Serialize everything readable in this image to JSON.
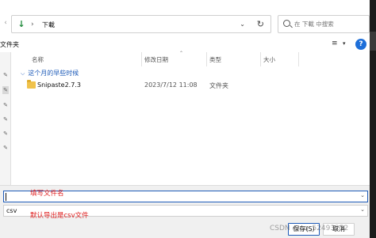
{
  "address_bar": {
    "breadcrumb": "下載",
    "separator": "›"
  },
  "search": {
    "placeholder": "在 下載 中搜索"
  },
  "toolbar": {
    "new_folder_label": "文件夹"
  },
  "columns": {
    "name": "名称",
    "date_modified": "修改日期",
    "type": "类型",
    "size": "大小"
  },
  "group": {
    "label": "这个月的早些时候"
  },
  "files": [
    {
      "name": "Snipaste2.7.3",
      "date_modified": "2023/7/12 11:08",
      "type": "文件夹"
    }
  ],
  "filename_field": {
    "annotation": "填写文件名"
  },
  "file_type": {
    "selected": "csv",
    "annotation": "默认导出是csv文件"
  },
  "buttons": {
    "save_label": "保存(S)",
    "cancel_label": "取消"
  },
  "watermark": {
    "text": "CSDN @qq_52493252"
  },
  "colors": {
    "accent": "#1e5bb8",
    "annotation_red": "#e02020",
    "folder_yellow": "#f0c24b",
    "download_green": "#1f8a3b"
  }
}
